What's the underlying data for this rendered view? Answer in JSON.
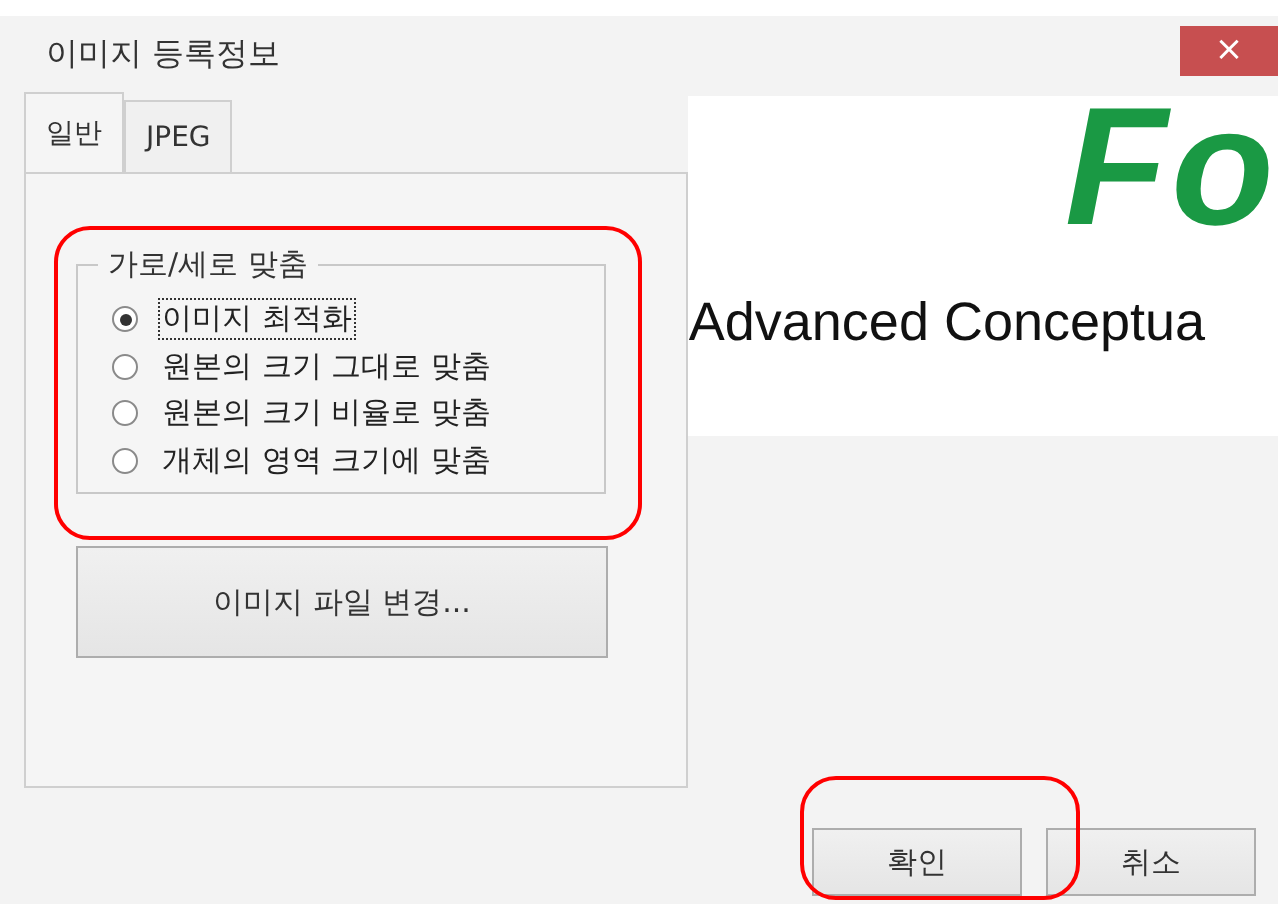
{
  "window": {
    "title": "이미지 등록정보",
    "close": "×"
  },
  "tabs": [
    {
      "label": "일반",
      "selected": true
    },
    {
      "label": "JPEG",
      "selected": false
    }
  ],
  "fit_group": {
    "title": "가로/세로 맞춤",
    "highlighted": true,
    "options": [
      {
        "label": "이미지 최적화",
        "selected": true,
        "focused": true
      },
      {
        "label": "원본의 크기 그대로 맞춤",
        "selected": false,
        "focused": false
      },
      {
        "label": "원본의 크기 비율로 맞춤",
        "selected": false,
        "focused": false
      },
      {
        "label": "개체의 영역 크기에 맞춤",
        "selected": false,
        "focused": false
      }
    ]
  },
  "change_file_button": {
    "label": "이미지 파일 변경..."
  },
  "preview": {
    "logo": "Fo",
    "tagline": "Advanced Conceptua"
  },
  "buttons": [
    {
      "label": "확인",
      "highlighted": true
    },
    {
      "label": "취소",
      "highlighted": false
    }
  ]
}
